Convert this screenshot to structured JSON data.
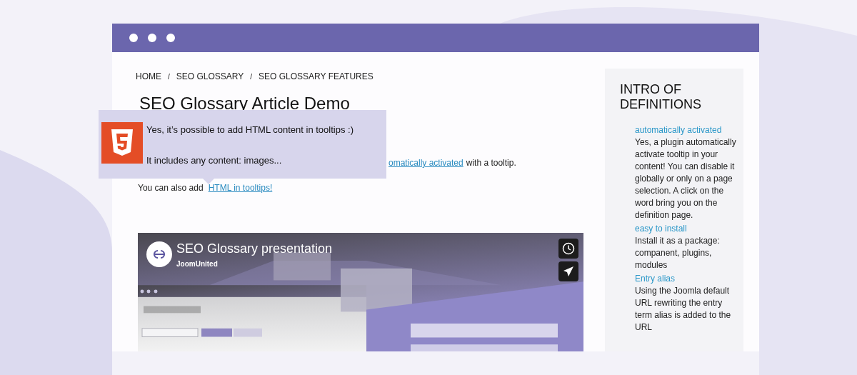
{
  "breadcrumb": {
    "separator": "/",
    "items": [
      "HOME",
      "SEO GLOSSARY",
      "SEO GLOSSARY FEATURES"
    ]
  },
  "article": {
    "title": "SEO Glossary Article Demo",
    "line_1": {
      "link": "omatically activated",
      "text": "with a tooltip."
    },
    "line_2": {
      "text": "You can also add",
      "link": "HTML in tooltips!"
    }
  },
  "tooltip": {
    "lines": [
      "Yes, it’s possible to add HTML content in tooltips :)",
      "It includes any content: images..."
    ]
  },
  "video": {
    "title": "SEO Glossary presentation",
    "channel": "JoomUnited"
  },
  "sidebar": {
    "title": "INTRO OF DEFINITIONS",
    "entries": [
      {
        "term": "automatically activated",
        "definition": "Yes, a plugin automatically activate tooltip in your content! You can disable it globally or only on a page selection. A click on the word bring you on the definition page."
      },
      {
        "term": "easy to install",
        "definition": "Install it as a package: companent, plugins, modules"
      },
      {
        "term": "Entry alias",
        "definition": "Using the Joomla default URL rewriting the entry term alias is added to the URL"
      }
    ]
  }
}
